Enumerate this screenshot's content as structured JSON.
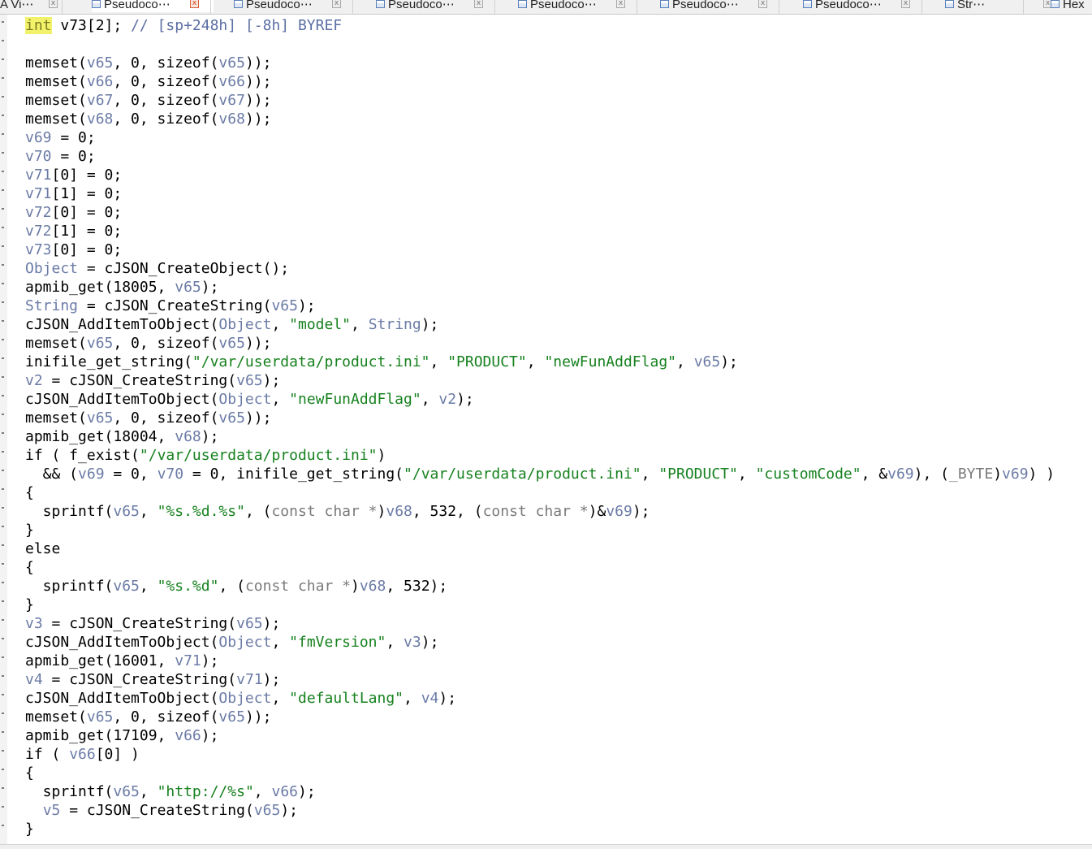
{
  "tabs": [
    {
      "label": "A Vi⋯",
      "active": false
    },
    {
      "label": "Pseudoco⋯",
      "active": true
    },
    {
      "label": "Pseudoco⋯",
      "active": false
    },
    {
      "label": "Pseudoco⋯",
      "active": false
    },
    {
      "label": "Pseudoco⋯",
      "active": false
    },
    {
      "label": "Pseudoco⋯",
      "active": false
    },
    {
      "label": "Pseudoco⋯",
      "active": false
    },
    {
      "label": "Str⋯",
      "active": false
    },
    {
      "label": "Hex",
      "active": false
    }
  ],
  "tab_close_glyph": "x",
  "code_lines": [
    [
      [
        "hl",
        "int"
      ],
      [
        "p",
        " v73[2]; "
      ],
      [
        "c",
        "// [sp+248h] [-8h] BYREF"
      ]
    ],
    [],
    [
      [
        "p",
        "memset("
      ],
      [
        "v",
        "v65"
      ],
      [
        "p",
        ", 0, sizeof("
      ],
      [
        "v",
        "v65"
      ],
      [
        "p",
        "));"
      ]
    ],
    [
      [
        "p",
        "memset("
      ],
      [
        "v",
        "v66"
      ],
      [
        "p",
        ", 0, sizeof("
      ],
      [
        "v",
        "v66"
      ],
      [
        "p",
        "));"
      ]
    ],
    [
      [
        "p",
        "memset("
      ],
      [
        "v",
        "v67"
      ],
      [
        "p",
        ", 0, sizeof("
      ],
      [
        "v",
        "v67"
      ],
      [
        "p",
        "));"
      ]
    ],
    [
      [
        "p",
        "memset("
      ],
      [
        "v",
        "v68"
      ],
      [
        "p",
        ", 0, sizeof("
      ],
      [
        "v",
        "v68"
      ],
      [
        "p",
        "));"
      ]
    ],
    [
      [
        "v",
        "v69"
      ],
      [
        "p",
        " = 0;"
      ]
    ],
    [
      [
        "v",
        "v70"
      ],
      [
        "p",
        " = 0;"
      ]
    ],
    [
      [
        "v",
        "v71"
      ],
      [
        "p",
        "[0] = 0;"
      ]
    ],
    [
      [
        "v",
        "v71"
      ],
      [
        "p",
        "[1] = 0;"
      ]
    ],
    [
      [
        "v",
        "v72"
      ],
      [
        "p",
        "[0] = 0;"
      ]
    ],
    [
      [
        "v",
        "v72"
      ],
      [
        "p",
        "[1] = 0;"
      ]
    ],
    [
      [
        "v",
        "v73"
      ],
      [
        "p",
        "[0] = 0;"
      ]
    ],
    [
      [
        "v",
        "Object"
      ],
      [
        "p",
        " = cJSON_CreateObject();"
      ]
    ],
    [
      [
        "p",
        "apmib_get(18005, "
      ],
      [
        "v",
        "v65"
      ],
      [
        "p",
        ");"
      ]
    ],
    [
      [
        "v",
        "String"
      ],
      [
        "p",
        " = cJSON_CreateString("
      ],
      [
        "v",
        "v65"
      ],
      [
        "p",
        ");"
      ]
    ],
    [
      [
        "p",
        "cJSON_AddItemToObject("
      ],
      [
        "v",
        "Object"
      ],
      [
        "p",
        ", "
      ],
      [
        "s",
        "\"model\""
      ],
      [
        "p",
        ", "
      ],
      [
        "v",
        "String"
      ],
      [
        "p",
        ");"
      ]
    ],
    [
      [
        "p",
        "memset("
      ],
      [
        "v",
        "v65"
      ],
      [
        "p",
        ", 0, sizeof("
      ],
      [
        "v",
        "v65"
      ],
      [
        "p",
        "));"
      ]
    ],
    [
      [
        "p",
        "inifile_get_string("
      ],
      [
        "s",
        "\"/var/userdata/product.ini\""
      ],
      [
        "p",
        ", "
      ],
      [
        "s",
        "\"PRODUCT\""
      ],
      [
        "p",
        ", "
      ],
      [
        "s",
        "\"newFunAddFlag\""
      ],
      [
        "p",
        ", "
      ],
      [
        "v",
        "v65"
      ],
      [
        "p",
        ");"
      ]
    ],
    [
      [
        "v",
        "v2"
      ],
      [
        "p",
        " = cJSON_CreateString("
      ],
      [
        "v",
        "v65"
      ],
      [
        "p",
        ");"
      ]
    ],
    [
      [
        "p",
        "cJSON_AddItemToObject("
      ],
      [
        "v",
        "Object"
      ],
      [
        "p",
        ", "
      ],
      [
        "s",
        "\"newFunAddFlag\""
      ],
      [
        "p",
        ", "
      ],
      [
        "v",
        "v2"
      ],
      [
        "p",
        ");"
      ]
    ],
    [
      [
        "p",
        "memset("
      ],
      [
        "v",
        "v65"
      ],
      [
        "p",
        ", 0, sizeof("
      ],
      [
        "v",
        "v65"
      ],
      [
        "p",
        "));"
      ]
    ],
    [
      [
        "p",
        "apmib_get(18004, "
      ],
      [
        "v",
        "v68"
      ],
      [
        "p",
        ");"
      ]
    ],
    [
      [
        "p",
        "if ( f_exist("
      ],
      [
        "s",
        "\"/var/userdata/product.ini\""
      ],
      [
        "p",
        ")"
      ]
    ],
    [
      [
        "p",
        "  && ("
      ],
      [
        "v",
        "v69"
      ],
      [
        "p",
        " = 0, "
      ],
      [
        "v",
        "v70"
      ],
      [
        "p",
        " = 0, inifile_get_string("
      ],
      [
        "s",
        "\"/var/userdata/product.ini\""
      ],
      [
        "p",
        ", "
      ],
      [
        "s",
        "\"PRODUCT\""
      ],
      [
        "p",
        ", "
      ],
      [
        "s",
        "\"customCode\""
      ],
      [
        "p",
        ", &"
      ],
      [
        "v",
        "v69"
      ],
      [
        "p",
        "), ("
      ],
      [
        "g",
        "_BYTE"
      ],
      [
        "p",
        ")"
      ],
      [
        "v",
        "v69"
      ],
      [
        "p",
        ") )"
      ]
    ],
    [
      [
        "p",
        "{"
      ]
    ],
    [
      [
        "p",
        "  sprintf("
      ],
      [
        "v",
        "v65"
      ],
      [
        "p",
        ", "
      ],
      [
        "s",
        "\"%s.%d.%s\""
      ],
      [
        "p",
        ", ("
      ],
      [
        "g",
        "const char *"
      ],
      [
        "p",
        ")"
      ],
      [
        "v",
        "v68"
      ],
      [
        "p",
        ", 532, ("
      ],
      [
        "g",
        "const char *"
      ],
      [
        "p",
        ")&"
      ],
      [
        "v",
        "v69"
      ],
      [
        "p",
        ");"
      ]
    ],
    [
      [
        "p",
        "}"
      ]
    ],
    [
      [
        "p",
        "else"
      ]
    ],
    [
      [
        "p",
        "{"
      ]
    ],
    [
      [
        "p",
        "  sprintf("
      ],
      [
        "v",
        "v65"
      ],
      [
        "p",
        ", "
      ],
      [
        "s",
        "\"%s.%d\""
      ],
      [
        "p",
        ", ("
      ],
      [
        "g",
        "const char *"
      ],
      [
        "p",
        ")"
      ],
      [
        "v",
        "v68"
      ],
      [
        "p",
        ", 532);"
      ]
    ],
    [
      [
        "p",
        "}"
      ]
    ],
    [
      [
        "v",
        "v3"
      ],
      [
        "p",
        " = cJSON_CreateString("
      ],
      [
        "v",
        "v65"
      ],
      [
        "p",
        ");"
      ]
    ],
    [
      [
        "p",
        "cJSON_AddItemToObject("
      ],
      [
        "v",
        "Object"
      ],
      [
        "p",
        ", "
      ],
      [
        "s",
        "\"fmVersion\""
      ],
      [
        "p",
        ", "
      ],
      [
        "v",
        "v3"
      ],
      [
        "p",
        ");"
      ]
    ],
    [
      [
        "p",
        "apmib_get(16001, "
      ],
      [
        "v",
        "v71"
      ],
      [
        "p",
        ");"
      ]
    ],
    [
      [
        "v",
        "v4"
      ],
      [
        "p",
        " = cJSON_CreateString("
      ],
      [
        "v",
        "v71"
      ],
      [
        "p",
        ");"
      ]
    ],
    [
      [
        "p",
        "cJSON_AddItemToObject("
      ],
      [
        "v",
        "Object"
      ],
      [
        "p",
        ", "
      ],
      [
        "s",
        "\"defaultLang\""
      ],
      [
        "p",
        ", "
      ],
      [
        "v",
        "v4"
      ],
      [
        "p",
        ");"
      ]
    ],
    [
      [
        "p",
        "memset("
      ],
      [
        "v",
        "v65"
      ],
      [
        "p",
        ", 0, sizeof("
      ],
      [
        "v",
        "v65"
      ],
      [
        "p",
        "));"
      ]
    ],
    [
      [
        "p",
        "apmib_get(17109, "
      ],
      [
        "v",
        "v66"
      ],
      [
        "p",
        ");"
      ]
    ],
    [
      [
        "p",
        "if ( "
      ],
      [
        "v",
        "v66"
      ],
      [
        "p",
        "[0] )"
      ]
    ],
    [
      [
        "p",
        "{"
      ]
    ],
    [
      [
        "p",
        "  sprintf("
      ],
      [
        "v",
        "v65"
      ],
      [
        "p",
        ", "
      ],
      [
        "s",
        "\"http://%s\""
      ],
      [
        "p",
        ", "
      ],
      [
        "v",
        "v66"
      ],
      [
        "p",
        ");"
      ]
    ],
    [
      [
        "p",
        "  "
      ],
      [
        "v",
        "v5"
      ],
      [
        "p",
        " = cJSON_CreateString("
      ],
      [
        "v",
        "v65"
      ],
      [
        "p",
        ");"
      ]
    ],
    [
      [
        "p",
        "}"
      ]
    ]
  ]
}
